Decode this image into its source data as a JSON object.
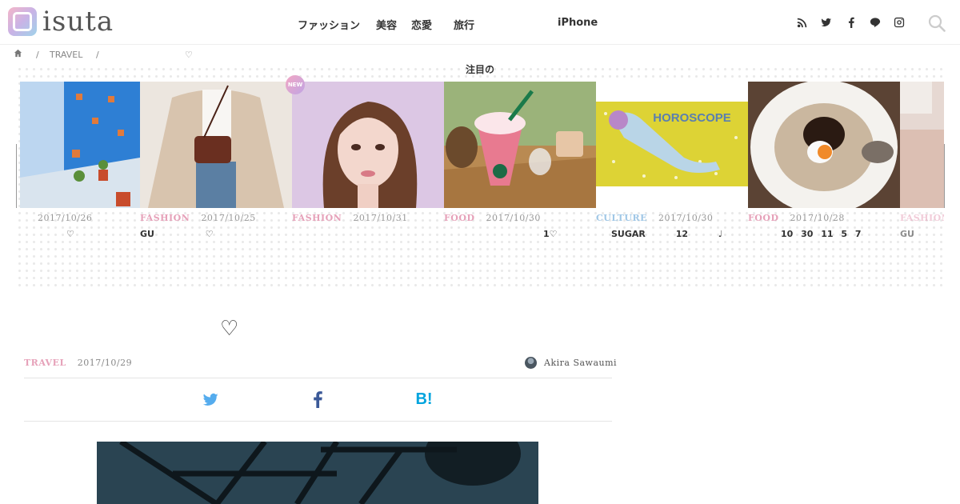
{
  "header": {
    "logo_text": "isuta",
    "nav": [
      "ファッション",
      "美容",
      "恋愛",
      "旅行",
      "iPhone"
    ],
    "social_icons": [
      "rss-icon",
      "twitter-icon",
      "facebook-icon",
      "line-icon",
      "instagram-icon"
    ],
    "search_icon": "search-icon"
  },
  "breadcrumb": {
    "home_icon": "home-icon",
    "sep1": "/",
    "category": "TRAVEL",
    "sep2": "/",
    "current": "♡"
  },
  "carousel": {
    "title": "注目の",
    "new_badge": "NEW",
    "cards": [
      {
        "category": "",
        "date": "2017/10/26",
        "title": "♡"
      },
      {
        "category": "FASHION",
        "date": "2017/10/25",
        "title": "GU ♡"
      },
      {
        "category": "FASHION",
        "date": "2017/10/31",
        "title": ""
      },
      {
        "category": "FOOD",
        "date": "2017/10/30",
        "title": "1♡"
      },
      {
        "category": "CULTURE",
        "date": "2017/10/30",
        "title": "SUGAR 12 ♩",
        "thumb_text": "HOROSCOPE"
      },
      {
        "category": "FOOD",
        "date": "2017/10/28",
        "title": "10 30 11 5 7"
      },
      {
        "category": "FASHION",
        "date": "",
        "title": "GU"
      }
    ]
  },
  "article": {
    "heading": "♡",
    "category": "TRAVEL",
    "date": "2017/10/29",
    "author": "Akira Sawaumi",
    "share_icons": [
      "twitter-icon",
      "facebook-icon",
      "hatena-bookmark-icon"
    ],
    "hatena_label": "B!"
  },
  "colors": {
    "category_pink": "#e6a1b9",
    "category_blue": "#a0c7e6",
    "twitter": "#55acee",
    "facebook": "#3b5998",
    "hatena": "#00a4de"
  }
}
